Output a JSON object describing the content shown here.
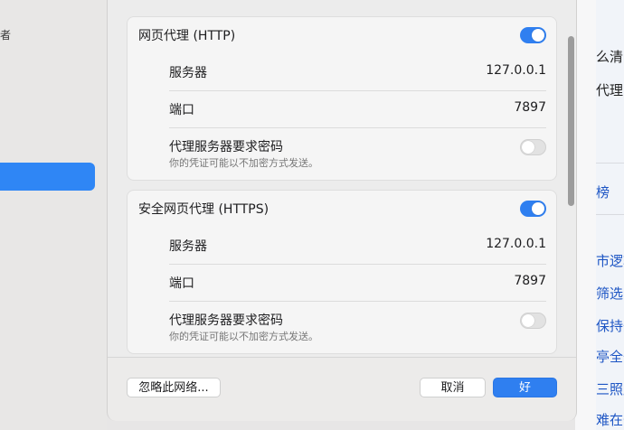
{
  "background": {
    "left_glyph": "者",
    "right_texts": [
      {
        "text": "么清除",
        "style": "dark"
      },
      {
        "text": "代理",
        "style": "dark"
      },
      {
        "text": "榜",
        "style": "blue"
      },
      {
        "text": "市逻辑",
        "style": "blue"
      },
      {
        "text": "筛选出",
        "style": "blue"
      },
      {
        "text": "保持开",
        "style": "blue"
      },
      {
        "text": "亭全开",
        "style": "blue"
      },
      {
        "text": "三照顾",
        "style": "blue"
      },
      {
        "text": "难在于",
        "style": "blue"
      }
    ]
  },
  "http_proxy": {
    "title": "网页代理 (HTTP)",
    "enabled": true,
    "server_label": "服务器",
    "server_value": "127.0.0.1",
    "port_label": "端口",
    "port_value": "7897",
    "auth_label": "代理服务器要求密码",
    "auth_desc": "你的凭证可能以不加密方式发送。",
    "auth_enabled": false
  },
  "https_proxy": {
    "title": "安全网页代理 (HTTPS)",
    "enabled": true,
    "server_label": "服务器",
    "server_value": "127.0.0.1",
    "port_label": "端口",
    "port_value": "7897",
    "auth_label": "代理服务器要求密码",
    "auth_desc": "你的凭证可能以不加密方式发送。",
    "auth_enabled": false
  },
  "footer": {
    "ignore_label": "忽略此网络...",
    "cancel_label": "取消",
    "ok_label": "好"
  },
  "colors": {
    "accent": "#2f7ff0",
    "link": "#1d55c4"
  }
}
